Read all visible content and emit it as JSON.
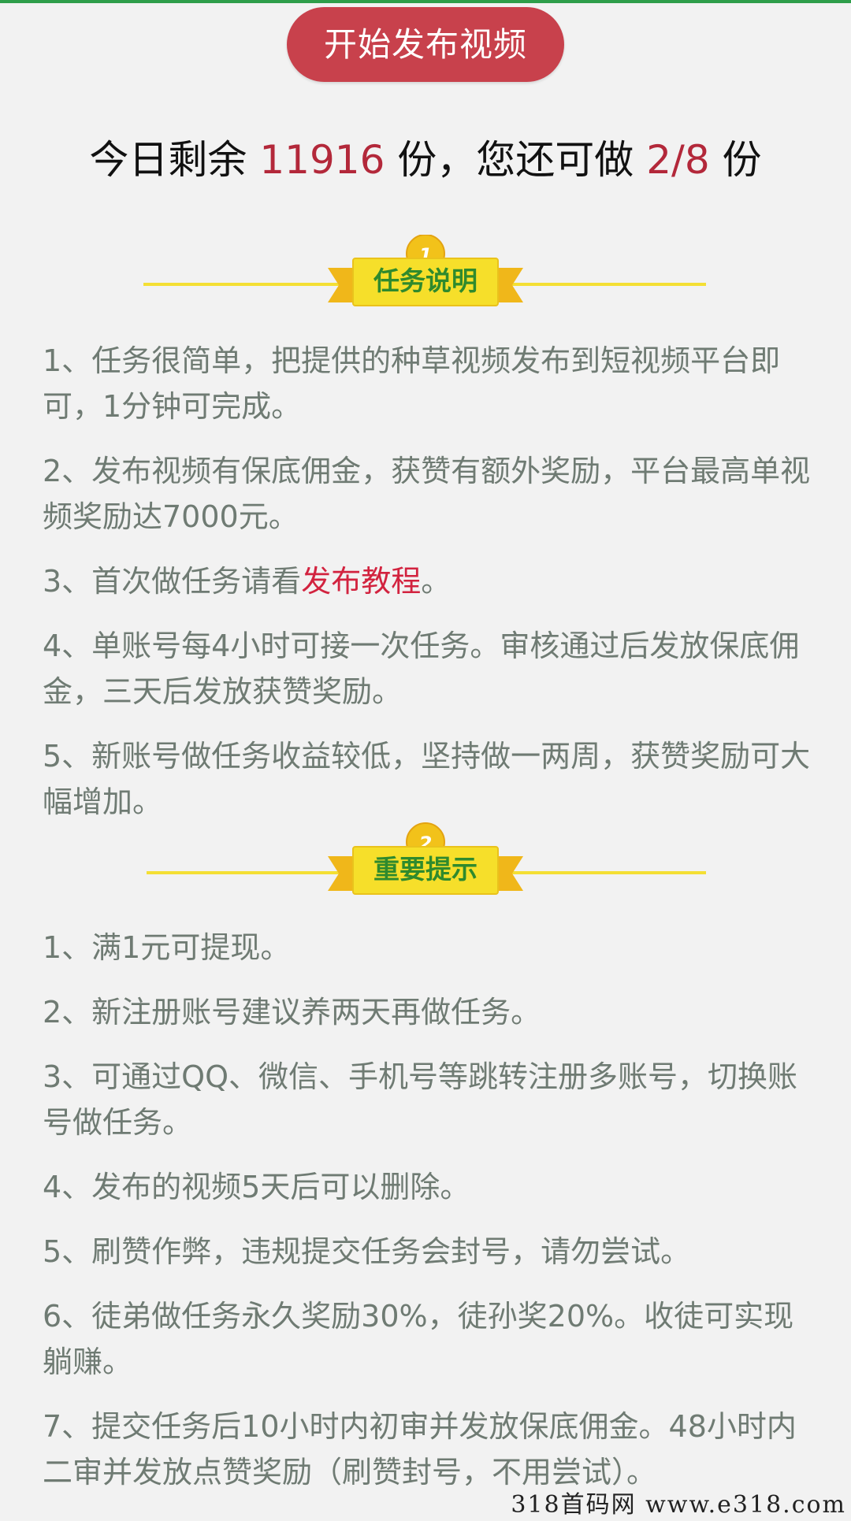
{
  "start_button": {
    "label": "开始发布视频"
  },
  "remaining": {
    "prefix": "今日剩余 ",
    "count": "11916",
    "middle": " 份，您还可做 ",
    "quota": "2/8",
    "suffix": " 份"
  },
  "section1": {
    "badge": "1",
    "title": "任务说明",
    "items": [
      {
        "text": "1、任务很简单，把提供的种草视频发布到短视频平台即可，1分钟可完成。"
      },
      {
        "text": "2、发布视频有保底佣金，获赞有额外奖励，平台最高单视频奖励达7000元。"
      },
      {
        "prefix": "3、首次做任务请看",
        "link": "发布教程",
        "suffix": "。"
      },
      {
        "text": "4、单账号每4小时可接一次任务。审核通过后发放保底佣金，三天后发放获赞奖励。"
      },
      {
        "text": "5、新账号做任务收益较低，坚持做一两周，获赞奖励可大幅增加。"
      }
    ]
  },
  "section2": {
    "badge": "2",
    "title": "重要提示",
    "items": [
      {
        "text": "1、满1元可提现。"
      },
      {
        "text": "2、新注册账号建议养两天再做任务。"
      },
      {
        "text": "3、可通过QQ、微信、手机号等跳转注册多账号，切换账号做任务。"
      },
      {
        "text": "4、发布的视频5天后可以删除。"
      },
      {
        "text": "5、刷赞作弊，违规提交任务会封号，请勿尝试。"
      },
      {
        "text": "6、徒弟做任务永久奖励30%，徒孙奖20%。收徒可实现躺赚。"
      },
      {
        "text": "7、提交任务后10小时内初审并发放保底佣金。48小时内二审并发放点赞奖励（刷赞封号，不用尝试）。"
      }
    ]
  },
  "watermark": {
    "text": "318首码网  www.e318.com"
  },
  "colors": {
    "button": "#c8414c",
    "highlight": "#b3283a",
    "link": "#d2233f",
    "ribbon": "#f6d21e",
    "title_green": "#2f8a2d"
  }
}
